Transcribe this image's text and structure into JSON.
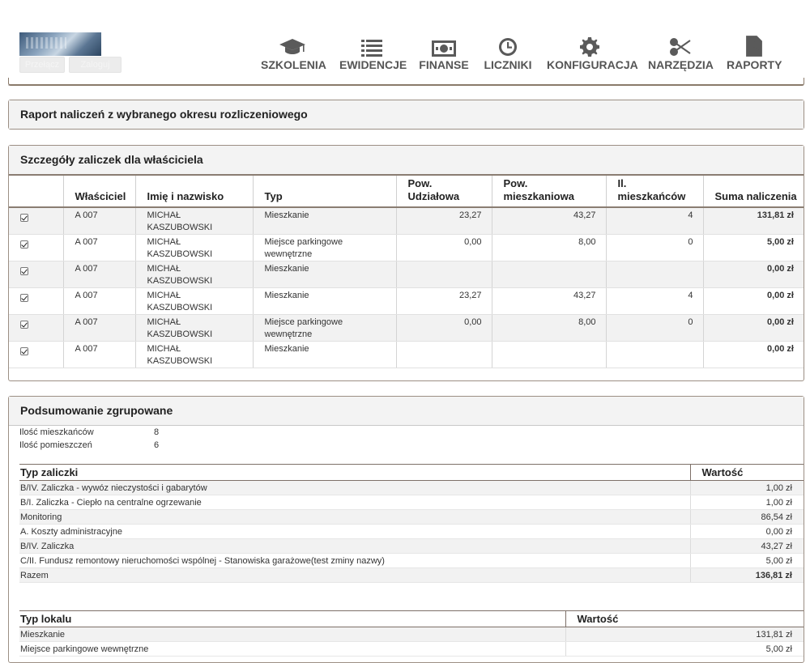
{
  "header": {
    "login_buttons": [
      "Przełącz",
      "Zaloguj"
    ],
    "nav": [
      {
        "label": "SZKOLENIA",
        "icon": "graduation-cap-icon"
      },
      {
        "label": "EWIDENCJE",
        "icon": "list-icon"
      },
      {
        "label": "FINANSE",
        "icon": "money-icon"
      },
      {
        "label": "LICZNIKI",
        "icon": "clock-icon"
      },
      {
        "label": "KONFIGURACJA",
        "icon": "gear-icon"
      },
      {
        "label": "NARZĘDZIA",
        "icon": "scissors-icon"
      },
      {
        "label": "RAPORTY",
        "icon": "pdf-file-icon"
      }
    ]
  },
  "report": {
    "title": "Raport naliczeń z wybranego okresu rozliczeniowego"
  },
  "details": {
    "title": "Szczegóły zaliczek dla właściciela",
    "columns": [
      "",
      "Właściciel",
      "Imię i nazwisko",
      "Typ",
      "Pow. Udziałowa",
      "Pow. mieszkaniowa",
      "Il. mieszkańców",
      "Suma naliczenia"
    ],
    "rows": [
      {
        "checked": true,
        "owner": "A 007",
        "name": "MICHAŁ KASZUBOWSKI",
        "type": "Mieszkanie",
        "share_area": "23,27",
        "living_area": "43,27",
        "residents": "4",
        "sum": "131,81 zł"
      },
      {
        "checked": true,
        "owner": "A 007",
        "name": "MICHAŁ KASZUBOWSKI",
        "type": "Miejsce parkingowe wewnętrzne",
        "share_area": "0,00",
        "living_area": "8,00",
        "residents": "0",
        "sum": "5,00 zł"
      },
      {
        "checked": true,
        "owner": "A 007",
        "name": "MICHAŁ KASZUBOWSKI",
        "type": "Mieszkanie",
        "share_area": "",
        "living_area": "",
        "residents": "",
        "sum": "0,00 zł"
      },
      {
        "checked": true,
        "owner": "A 007",
        "name": "MICHAŁ KASZUBOWSKI",
        "type": "Mieszkanie",
        "share_area": "23,27",
        "living_area": "43,27",
        "residents": "4",
        "sum": "0,00 zł"
      },
      {
        "checked": true,
        "owner": "A 007",
        "name": "MICHAŁ KASZUBOWSKI",
        "type": "Miejsce parkingowe wewnętrzne",
        "share_area": "0,00",
        "living_area": "8,00",
        "residents": "0",
        "sum": "0,00 zł"
      },
      {
        "checked": true,
        "owner": "A 007",
        "name": "MICHAŁ KASZUBOWSKI",
        "type": "Mieszkanie",
        "share_area": "",
        "living_area": "",
        "residents": "",
        "sum": "0,00 zł"
      }
    ]
  },
  "summary": {
    "title": "Podsumowanie zgrupowane",
    "stats": [
      {
        "label": "Ilość mieszkańców",
        "value": "8"
      },
      {
        "label": "Ilość pomieszczeń",
        "value": "6"
      }
    ],
    "advance_table": {
      "headers": [
        "Typ zaliczki",
        "Wartość"
      ],
      "rows": [
        {
          "type": "B/IV. Zaliczka - wywóz nieczystości i gabarytów",
          "value": "1,00 zł"
        },
        {
          "type": "B/I. Zaliczka - Ciepło na centralne ogrzewanie",
          "value": "1,00 zł"
        },
        {
          "type": "Monitoring",
          "value": "86,54 zł"
        },
        {
          "type": "A. Koszty administracyjne",
          "value": "0,00 zł"
        },
        {
          "type": "B/IV. Zaliczka",
          "value": "43,27 zł"
        },
        {
          "type": "C/II. Fundusz remontowy nieruchomości wspólnej - Stanowiska garażowe(test zminy nazwy)",
          "value": "5,00 zł"
        },
        {
          "type": "Razem",
          "value": "136,81 zł"
        }
      ]
    },
    "unit_table": {
      "headers": [
        "Typ lokalu",
        "Wartość"
      ],
      "rows": [
        {
          "type": "Mieszkanie",
          "value": "131,81 zł"
        },
        {
          "type": "Miejsce parkingowe wewnętrzne",
          "value": "5,00 zł"
        }
      ]
    }
  }
}
